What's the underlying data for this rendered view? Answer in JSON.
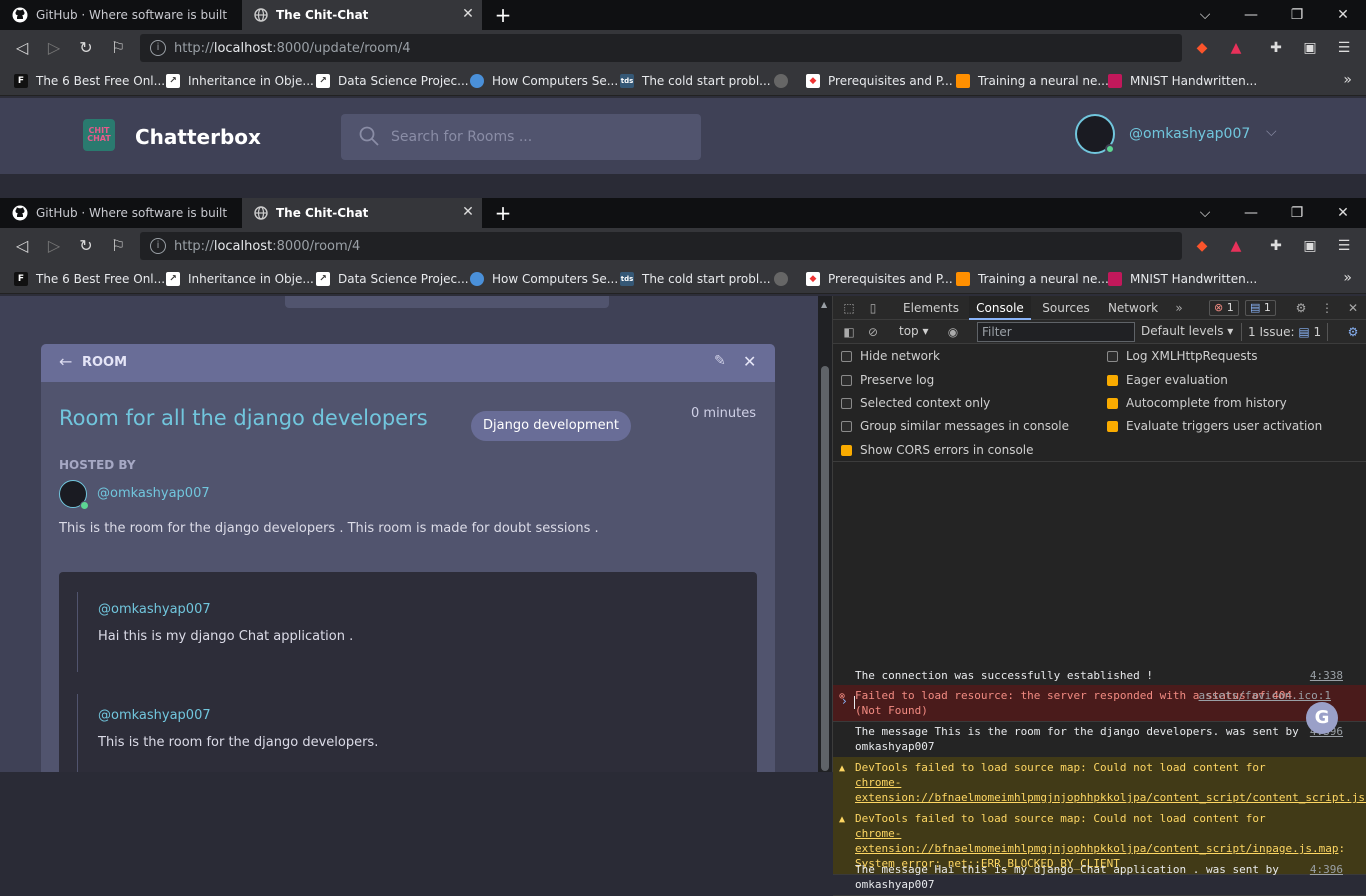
{
  "browser_top": {
    "tabs": [
      {
        "title": "GitHub · Where software is built",
        "active": false
      },
      {
        "title": "The Chit-Chat",
        "active": true
      }
    ],
    "url_prefix": "http://",
    "url_host": "localhost",
    "url_path": ":8000/update/room/4"
  },
  "browser_bottom": {
    "tabs": [
      {
        "title": "GitHub · Where software is built",
        "active": false
      },
      {
        "title": "The Chit-Chat",
        "active": true
      }
    ],
    "url_prefix": "http://",
    "url_host": "localhost",
    "url_path": ":8000/room/4"
  },
  "bookmarks": [
    {
      "label": "The 6 Best Free Onl...",
      "icon": "F"
    },
    {
      "label": "Inheritance in Obje...",
      "icon": ""
    },
    {
      "label": "Data Science Projec...",
      "icon": ""
    },
    {
      "label": "How Computers Se...",
      "icon": ""
    },
    {
      "label": "The cold start probl...",
      "icon": "tds"
    },
    {
      "label": "",
      "icon": ""
    },
    {
      "label": "Prerequisites and P...",
      "icon": ""
    },
    {
      "label": "Training a neural ne...",
      "icon": ""
    },
    {
      "label": "MNIST Handwritten...",
      "icon": ""
    }
  ],
  "chatterbox": {
    "logo_text": "CHIT CHAT",
    "brand": "Chatterbox",
    "search_placeholder": "Search for Rooms ...",
    "username": "@omkashyap007"
  },
  "room": {
    "header_label": "ROOM",
    "title": "Room for all the django developers",
    "topic": "Django development",
    "time": "0 minutes",
    "hosted_by_label": "HOSTED BY",
    "host": "@omkashyap007",
    "description": "This is the room for the django developers . This room is made for doubt sessions .",
    "messages": [
      {
        "user": "@omkashyap007",
        "text": "Hai this is my django Chat application ."
      },
      {
        "user": "@omkashyap007",
        "text": "This is the room for the django developers."
      }
    ]
  },
  "devtools": {
    "tabs": [
      "Elements",
      "Console",
      "Sources",
      "Network"
    ],
    "error_count": "1",
    "message_count": "1",
    "context": "top",
    "filter_placeholder": "Filter",
    "levels": "Default levels",
    "issues_label": "1 Issue:",
    "issues_count": "1",
    "settings_left": [
      {
        "label": "Hide network",
        "checked": false
      },
      {
        "label": "Preserve log",
        "checked": false
      },
      {
        "label": "Selected context only",
        "checked": false
      },
      {
        "label": "Group similar messages in console",
        "checked": false
      },
      {
        "label": "Show CORS errors in console",
        "checked": true
      }
    ],
    "settings_right": [
      {
        "label": "Log XMLHttpRequests",
        "checked": false
      },
      {
        "label": "Eager evaluation",
        "checked": true
      },
      {
        "label": "Autocomplete from history",
        "checked": true
      },
      {
        "label": "Evaluate triggers user activation",
        "checked": true
      }
    ],
    "logs": [
      {
        "type": "info",
        "text": "The connection was successfully established !",
        "source": "4:338"
      },
      {
        "type": "error",
        "text": "Failed to load resource: the server responded with a status of 404 (Not Found)",
        "source": "assets/favicon.ico:1"
      },
      {
        "type": "info",
        "text": "The message This is the room for the django developers.  was sent by omkashyap007",
        "source": "4:396"
      },
      {
        "type": "warn",
        "text_pre": "DevTools failed to load source map: Could not load content for ",
        "link": "chrome-extension://bfnaelmomeimhlpmgjnjophhpkkoljpa/content_script/content_script.js.map",
        "text_post": ": System error: net::ERR_BLOCKED_BY_CLIENT"
      },
      {
        "type": "warn",
        "text_pre": "DevTools failed to load source map: Could not load content for ",
        "link": "chrome-extension://bfnaelmomeimhlpmgjnjophhpkkoljpa/content_script/inpage.js.map",
        "text_post": ": System error: net::ERR_BLOCKED_BY_CLIENT"
      },
      {
        "type": "info",
        "text": "The message Hai this is my django Chat application . was sent by omkashyap007",
        "source": "4:396"
      }
    ]
  }
}
